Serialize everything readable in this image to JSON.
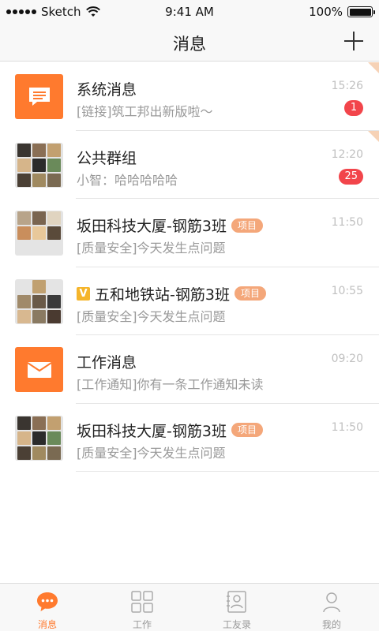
{
  "status_bar": {
    "carrier": "Sketch",
    "time": "9:41 AM",
    "battery": "100%"
  },
  "nav": {
    "title": "消息"
  },
  "messages": [
    {
      "title": "系统消息",
      "preview": "[链接]筑工邦出新版啦～",
      "time": "15:26",
      "unread": "1",
      "avatar": "chat-icon",
      "pinned": true
    },
    {
      "title": "公共群组",
      "preview": "小智：哈哈哈哈哈",
      "time": "12:20",
      "unread": "25",
      "avatar": "group-avatar",
      "pinned": true
    },
    {
      "title": "坂田科技大厦-钢筋3班",
      "tag": "项目",
      "preview": "[质量安全]今天发生点问题",
      "time": "11:50",
      "avatar": "group-avatar"
    },
    {
      "title": "五和地铁站-钢筋3班",
      "tag": "项目",
      "badge": "V",
      "preview": "[质量安全]今天发生点问题",
      "time": "10:55",
      "avatar": "group-avatar"
    },
    {
      "title": "工作消息",
      "preview": "[工作通知]你有一条工作通知未读",
      "time": "09:20",
      "avatar": "envelope-icon"
    },
    {
      "title": "坂田科技大厦-钢筋3班",
      "tag": "项目",
      "preview": "[质量安全]今天发生点问题",
      "time": "11:50",
      "avatar": "group-avatar"
    }
  ],
  "tabs": [
    {
      "label": "消息",
      "icon": "message-bubble-icon",
      "active": true
    },
    {
      "label": "工作",
      "icon": "grid-icon"
    },
    {
      "label": "工友录",
      "icon": "contacts-icon"
    },
    {
      "label": "我的",
      "icon": "person-icon"
    }
  ],
  "colors": {
    "accent": "#ff7a2e",
    "badge": "#f2454b",
    "tag": "#f4a77a"
  }
}
